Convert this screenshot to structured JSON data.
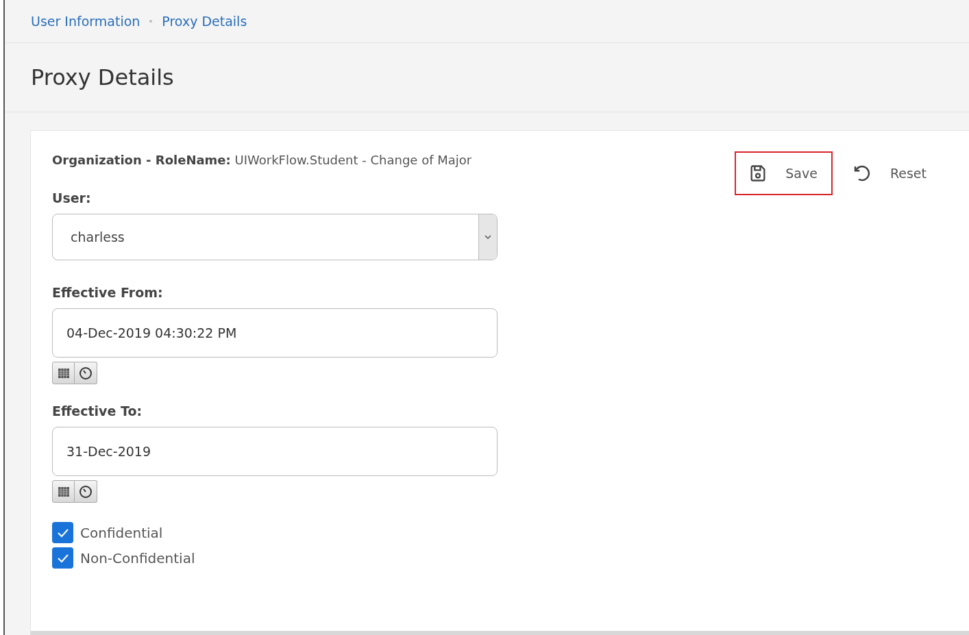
{
  "breadcrumb": [
    {
      "label": "User Information"
    },
    {
      "label": "Proxy Details"
    }
  ],
  "title": "Proxy Details",
  "org_role": {
    "label": "Organization - RoleName:",
    "value": "UIWorkFlow.Student - Change of Major"
  },
  "actions": [
    {
      "kind": "save",
      "label": "Save",
      "highlighted": true
    },
    {
      "kind": "reset",
      "label": "Reset",
      "highlighted": false
    }
  ],
  "fields": [
    {
      "kind": "select",
      "label": "User:",
      "value": "charless"
    },
    {
      "kind": "datetime",
      "label": "Effective From:",
      "value": "04-Dec-2019 04:30:22 PM"
    },
    {
      "kind": "datetime",
      "label": "Effective To:",
      "value": "31-Dec-2019"
    }
  ],
  "checkboxes": [
    {
      "label": "Confidential",
      "checked": true
    },
    {
      "label": "Non-Confidential",
      "checked": true
    }
  ]
}
